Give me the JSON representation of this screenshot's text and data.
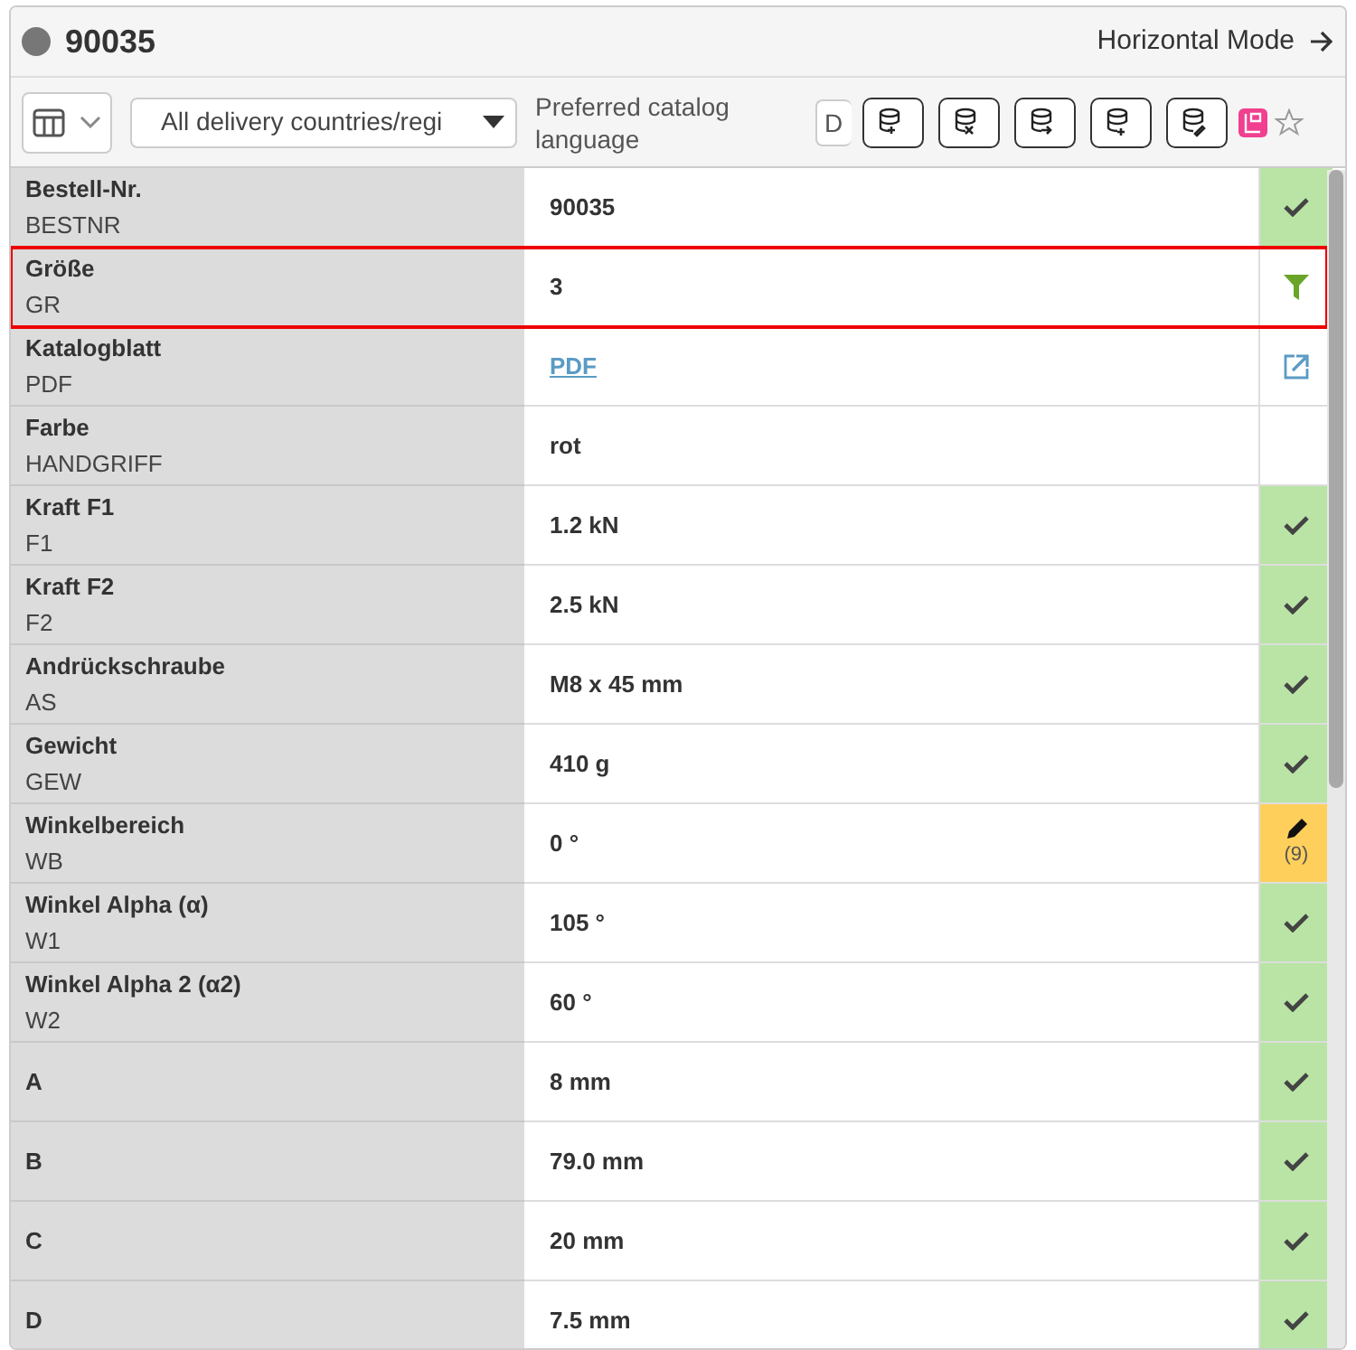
{
  "header": {
    "title": "90035",
    "mode_link": "Horizontal Mode"
  },
  "toolbar": {
    "country_select": "All delivery countries/regi",
    "language_label": "Preferred catalog language",
    "language_value": "D"
  },
  "rows": [
    {
      "label": "Bestell-Nr.",
      "code": "BESTNR",
      "value": "90035",
      "link": false,
      "kind": "check",
      "highlighted": false
    },
    {
      "label": "Größe",
      "code": "GR",
      "value": "3",
      "link": false,
      "kind": "filter",
      "highlighted": true
    },
    {
      "label": "Katalogblatt",
      "code": "PDF",
      "value": "PDF",
      "link": true,
      "kind": "external",
      "highlighted": false
    },
    {
      "label": "Farbe",
      "code": "HANDGRIFF",
      "value": "rot",
      "link": false,
      "kind": "none",
      "highlighted": false
    },
    {
      "label": "Kraft F1",
      "code": "F1",
      "value": "1.2 kN",
      "link": false,
      "kind": "check",
      "highlighted": false
    },
    {
      "label": "Kraft F2",
      "code": "F2",
      "value": "2.5 kN",
      "link": false,
      "kind": "check",
      "highlighted": false
    },
    {
      "label": "Andrückschraube",
      "code": "AS",
      "value": "M8 x 45 mm",
      "link": false,
      "kind": "check",
      "highlighted": false
    },
    {
      "label": "Gewicht",
      "code": "GEW",
      "value": "410 g",
      "link": false,
      "kind": "check",
      "highlighted": false
    },
    {
      "label": "Winkelbereich",
      "code": "WB",
      "value": "0 °",
      "link": false,
      "kind": "edit",
      "count": "(9)",
      "highlighted": false
    },
    {
      "label": "Winkel Alpha (α)",
      "code": "W1",
      "value": "105 °",
      "link": false,
      "kind": "check",
      "highlighted": false
    },
    {
      "label": "Winkel Alpha 2 (α2)",
      "code": "W2",
      "value": "60 °",
      "link": false,
      "kind": "check",
      "highlighted": false
    },
    {
      "label": "A",
      "value": "8 mm",
      "link": false,
      "kind": "check",
      "highlighted": false
    },
    {
      "label": "B",
      "value": "79.0 mm",
      "link": false,
      "kind": "check",
      "highlighted": false
    },
    {
      "label": "C",
      "value": "20 mm",
      "link": false,
      "kind": "check",
      "highlighted": false
    },
    {
      "label": "D",
      "value": "7.5 mm",
      "link": false,
      "kind": "check",
      "highlighted": false
    }
  ]
}
